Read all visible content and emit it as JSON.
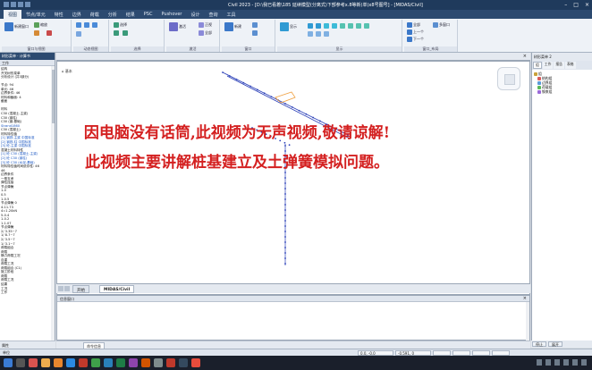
{
  "titlebar": {
    "title": "Civil 2023 - [D:\\我已看着\\185 延续模型(分离式)下部参考x.8等新(单)x8号图号] - [MIDAS/Civil]"
  },
  "menu": [
    {
      "label": "视图"
    },
    {
      "label": "节点/单元"
    },
    {
      "label": "特性"
    },
    {
      "label": "边界"
    },
    {
      "label": "荷载"
    },
    {
      "label": "分析"
    },
    {
      "label": "结果"
    },
    {
      "label": "PSC"
    },
    {
      "label": "Pushover"
    },
    {
      "label": "设计"
    },
    {
      "label": "查询"
    },
    {
      "label": "工具"
    }
  ],
  "ribbon": {
    "groups": [
      {
        "label": "窗口与视图"
      },
      {
        "label": "动态视图"
      },
      {
        "label": "选择"
      },
      {
        "label": "激活"
      },
      {
        "label": "窗口"
      },
      {
        "label": "显示"
      },
      {
        "label": "窗口_布局"
      }
    ],
    "buttons": {
      "b1": "新建窗口",
      "b2": "缩放",
      "b3": "选择",
      "b4": "激活",
      "b5": "正视",
      "b6": "全部",
      "b7": "新建",
      "b8": "显示",
      "b9": "全部",
      "b10": "上一个",
      "b11": "下一个",
      "b12": "多窗口"
    }
  },
  "left_panel": {
    "header": "树形菜单 · 计算书",
    "tab": "工作",
    "items": [
      "结构",
      "开关树形菜单",
      "分析设计 (共3部分)",
      "",
      "节点: 94",
      "单元: 46",
      "边界条件: 46",
      "材料和截面: 4",
      "截面",
      "",
      "材料",
      "C30 (混凝土-主梁)",
      "C30 (钢柱)",
      "C30 (钢-基础)",
      "Strand1860",
      "C30 (混凝土)",
      "材料特性值",
      "[1] 钢铁-主梁 中国标准",
      "[2] 钢铁-柱 中国标准",
      "[3] 砼-主梁 中国标准",
      "混凝土材料特性",
      "[1] 砼 C30 (混凝土-主梁)",
      "[2] 砼 C30 (钢柱)",
      "[3] 砼 C30 (水泥-基础)",
      "材料特性值时间依存性: 46",
      "46",
      "边界条件",
      "一般支承",
      "弹性连接",
      "节点弹簧",
      "1-0",
      "0.5",
      "1-0.5",
      "节点弹簧 0",
      "4-11.73",
      "4=1.20kN",
      "5-0.4",
      "1-0.2",
      "1-1.07",
      "节点弹簧",
      "2/ 3.35~7",
      "1/ 8.7~7",
      "2/ 3.5~7",
      "1/ 3.1~7",
      "荷载组合",
      "荷载",
      "静力荷载工况",
      "自重",
      "荷载工况",
      "荷载组合 (C1)",
      "施工阶段",
      "荷载",
      "荷载工况",
      "结果",
      "工况",
      "工作"
    ],
    "footer": "属性"
  },
  "view": {
    "tab": "",
    "label": "基本"
  },
  "subtitles": {
    "line1": "因电脑没有话筒,此视频为无声视频,敬请谅解!",
    "line2": "此视频主要讲解桩基建立及土弹簧模拟问题。"
  },
  "doc_tabs": {
    "tab1": "开始",
    "tab2": "MIDAS/Civil"
  },
  "right_panel": {
    "header": "树形菜单 2",
    "tabs": [
      "组",
      "工作",
      "报告",
      "表格"
    ],
    "items": [
      {
        "label": "组"
      },
      {
        "label": "结构组"
      },
      {
        "label": "边界组"
      },
      {
        "label": "荷载组"
      },
      {
        "label": "钢束组"
      }
    ],
    "buttons": [
      "停止",
      "展开"
    ]
  },
  "message": {
    "header": "信息窗口"
  },
  "command_tabs": {
    "tab1": "命令信息"
  },
  "status": {
    "left": "单位",
    "coord1": "0.0, -0.0",
    "coord2": "-0.591, 0"
  },
  "colors": {
    "accent": "#2c4a70",
    "subtitle": "#d42020",
    "model_line": "#2a3fb8",
    "highlight": "#f0a040"
  }
}
